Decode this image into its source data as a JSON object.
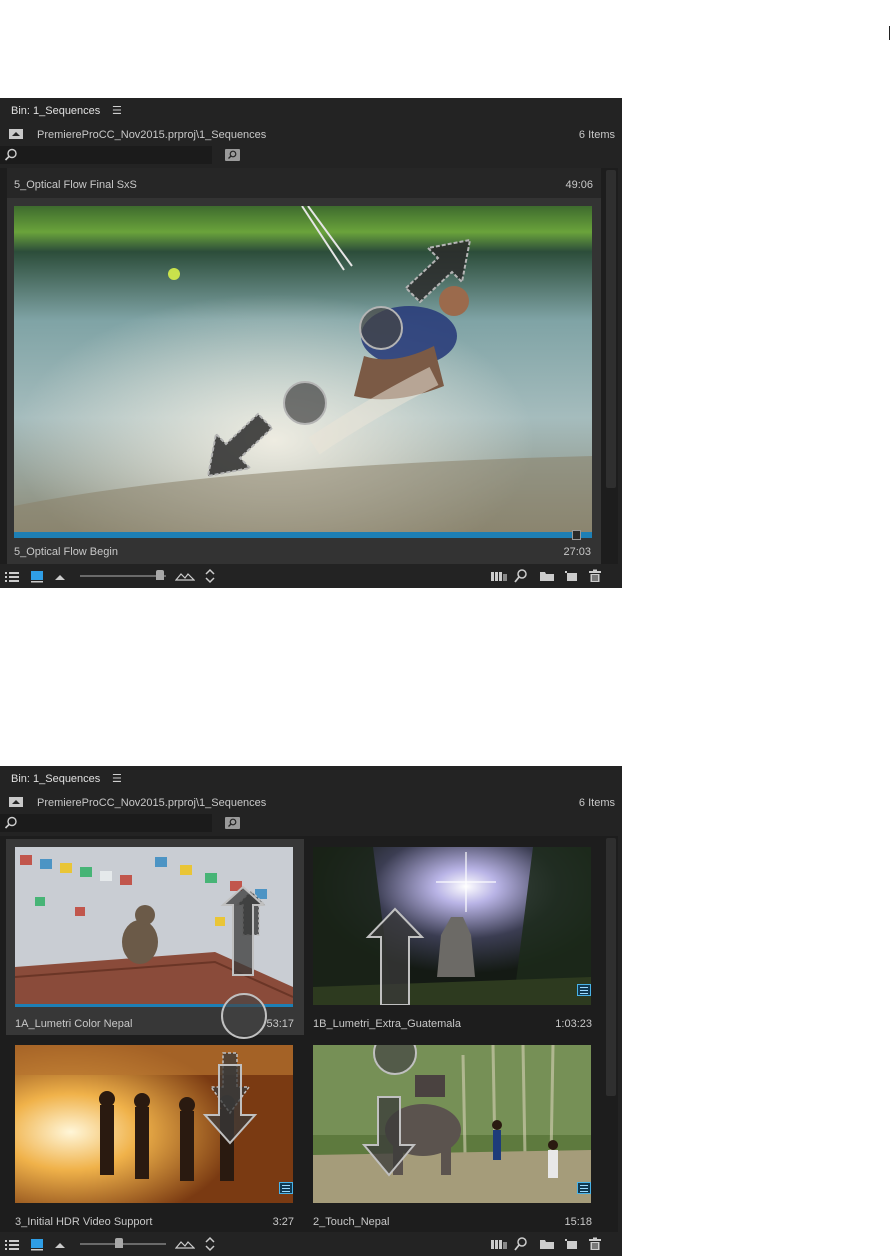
{
  "panel_a": {
    "tab_title": "Bin: 1_Sequences",
    "tab_menu_glyph": "☰",
    "path": "PremiereProCC_Nov2015.prproj\\1_Sequences",
    "items_count": "6 Items",
    "search_value": "",
    "item": {
      "name_top": "5_Optical Flow Final SxS",
      "duration_top": "49:06",
      "name_bottom": "5_Optical Flow Begin",
      "duration_bottom": "27:03",
      "thumbnail": "water-skier",
      "progress": 0.98
    },
    "zoom_level": 0.97
  },
  "panel_b": {
    "tab_title": "Bin: 1_Sequences",
    "tab_menu_glyph": "☰",
    "path": "PremiereProCC_Nov2015.prproj\\1_Sequences",
    "items_count": "6 Items",
    "search_value": "",
    "items": [
      {
        "name": "1A_Lumetri Color Nepal",
        "duration": "53:17",
        "thumbnail": "monkey-prayer-flags",
        "selected": true
      },
      {
        "name": "1B_Lumetri_Extra_Guatemala",
        "duration": "1:03:23",
        "thumbnail": "jungle-temple-sun"
      },
      {
        "name": "3_Initial HDR Video Support",
        "duration": "3:27",
        "thumbnail": "musicians-fire"
      },
      {
        "name": "2_Touch_Nepal",
        "duration": "15:18",
        "thumbnail": "elephant-forest"
      }
    ],
    "zoom_level": 0.45
  },
  "icons": {
    "list_view": "list-view-icon",
    "icon_view": "icon-view-icon",
    "zoom_small": "zoom-out-mountain-icon",
    "zoom_large": "zoom-in-mountains-icon",
    "sort": "sort-icons-icon",
    "automate": "automate-to-sequence-icon",
    "find": "find-icon",
    "new_bin": "new-bin-folder-icon",
    "new_item": "new-item-icon",
    "clear": "trash-icon",
    "seq_badge": "sequence-badge-icon"
  },
  "colors": {
    "panel_bg": "#232323",
    "content_bg": "#1d1d1d",
    "accent_blue": "#1d7fb5",
    "text": "#c8c8c8"
  }
}
